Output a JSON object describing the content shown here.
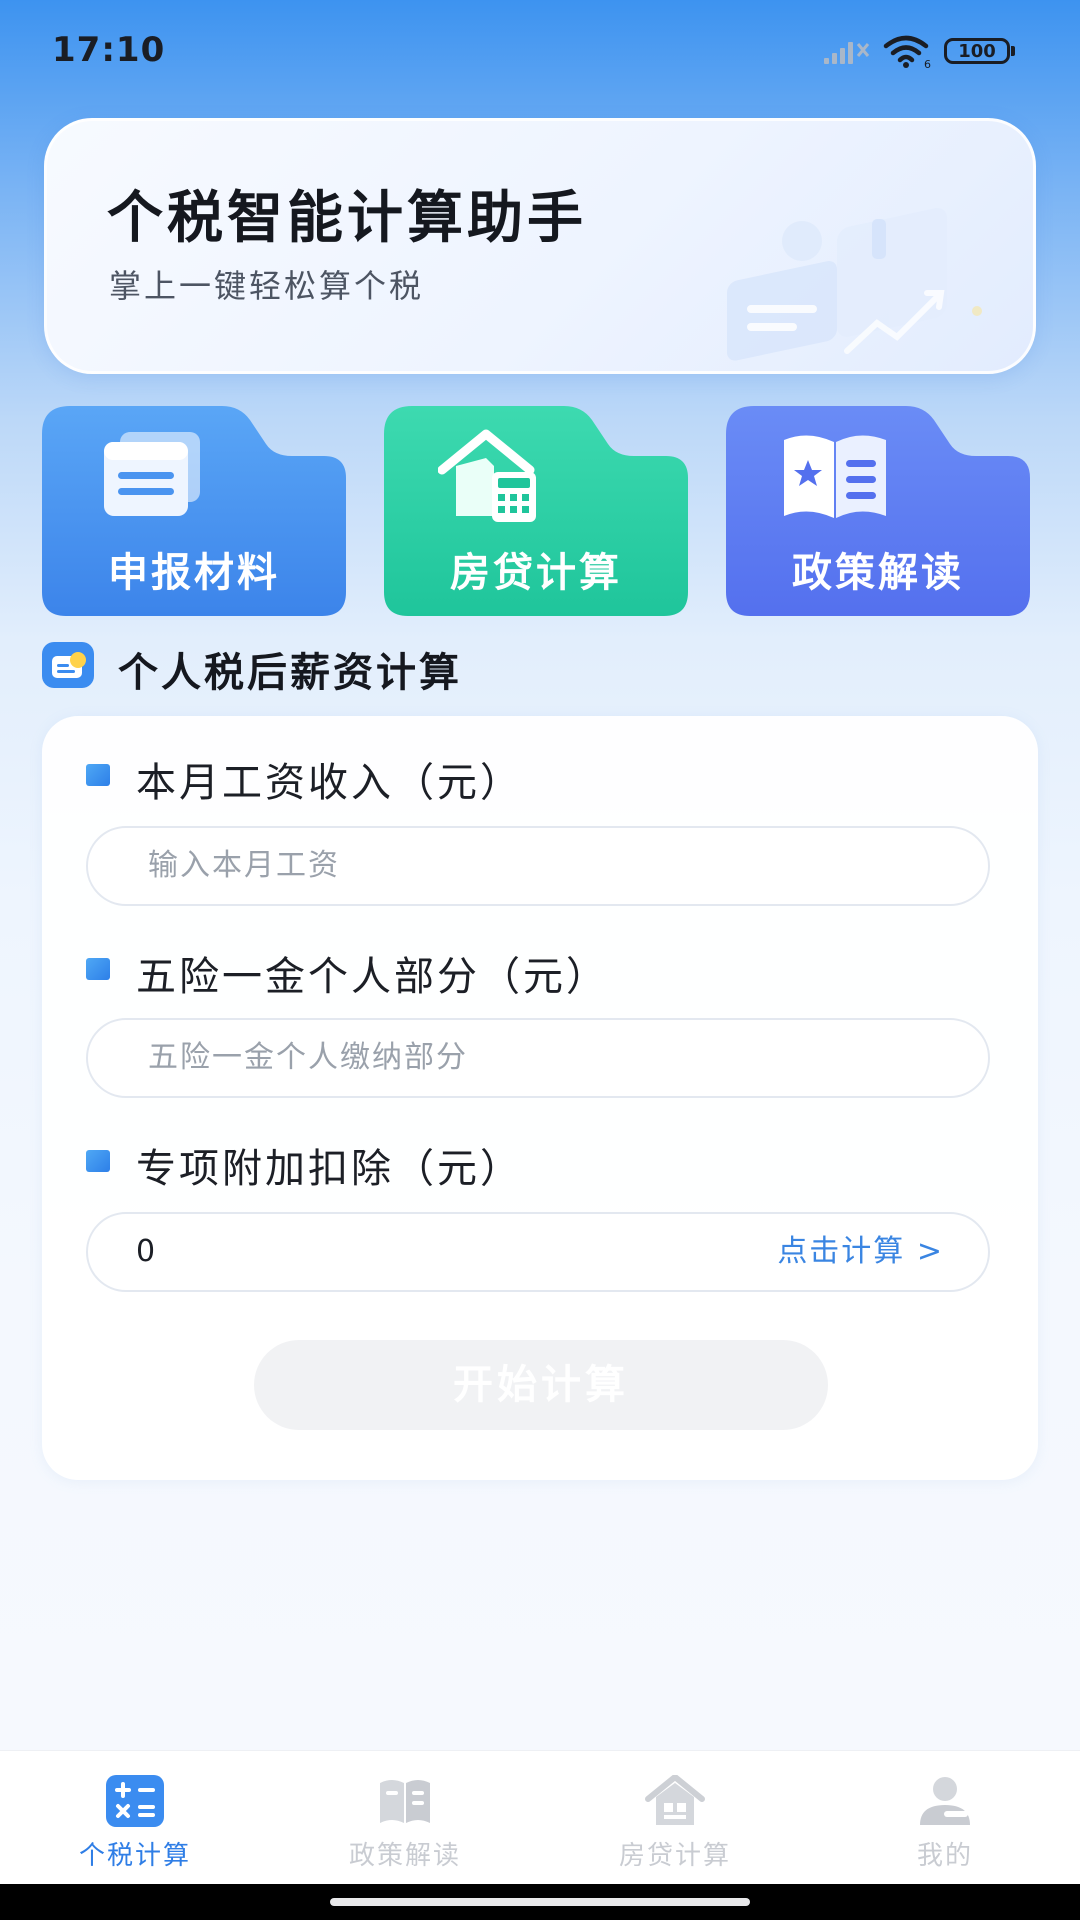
{
  "status_bar": {
    "time": "17:10",
    "battery": "100",
    "icons": [
      "signal-icon",
      "wifi-icon",
      "battery-icon"
    ]
  },
  "banner": {
    "title": "个税智能计算助手",
    "subtitle": "掌上一键轻松算个税"
  },
  "features": [
    {
      "label": "申报材料",
      "icon": "documents-icon",
      "color": "#4a94f0"
    },
    {
      "label": "房贷计算",
      "icon": "house-calculator-icon",
      "color": "#2fcfa6"
    },
    {
      "label": "政策解读",
      "icon": "book-star-icon",
      "color": "#5b7cf2"
    }
  ],
  "section": {
    "title": "个人税后薪资计算"
  },
  "form": {
    "salary": {
      "label": "本月工资收入（元）",
      "placeholder": "输入本月工资"
    },
    "insurance": {
      "label": "五险一金个人部分（元）",
      "placeholder": "五险一金个人缴纳部分"
    },
    "deduction": {
      "label": "专项附加扣除（元）",
      "value": "0",
      "link": "点击计算 >"
    },
    "submit": "开始计算"
  },
  "bottom_nav": [
    {
      "label": "个税计算",
      "icon": "calculator-icon",
      "active": true
    },
    {
      "label": "政策解读",
      "icon": "book-icon",
      "active": false
    },
    {
      "label": "房贷计算",
      "icon": "house-icon",
      "active": false
    },
    {
      "label": "我的",
      "icon": "user-icon",
      "active": false
    }
  ],
  "colors": {
    "accent": "#2f7ee6",
    "link": "#3a85e2",
    "inactive": "#c9ccd2"
  }
}
